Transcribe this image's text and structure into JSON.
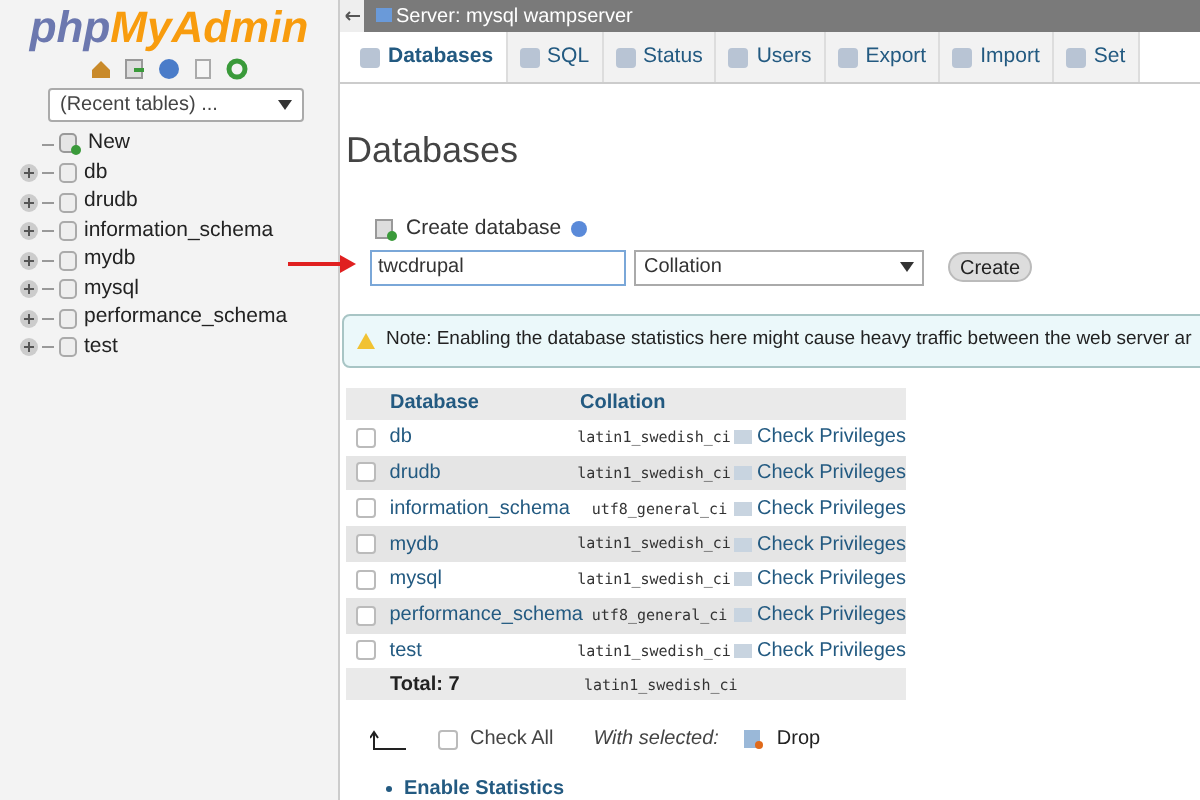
{
  "sidebar": {
    "logo": {
      "part_1": "php",
      "part_2": "MyAdmin"
    },
    "recent_tables": "(Recent tables) ...",
    "tree": [
      {
        "label": "New",
        "kind": "new"
      },
      {
        "label": "db",
        "kind": "database"
      },
      {
        "label": "drudb",
        "kind": "database"
      },
      {
        "label": "information_schema",
        "kind": "database"
      },
      {
        "label": "mydb",
        "kind": "database"
      },
      {
        "label": "mysql",
        "kind": "database"
      },
      {
        "label": "performance_schema",
        "kind": "database"
      },
      {
        "label": "test",
        "kind": "database"
      }
    ]
  },
  "breadcrumb": "Server: mysql wampserver",
  "tabs": [
    {
      "label": "Databases",
      "selected": true
    },
    {
      "label": "SQL",
      "selected": false
    },
    {
      "label": "Status",
      "selected": false
    },
    {
      "label": "Users",
      "selected": false
    },
    {
      "label": "Export",
      "selected": false
    },
    {
      "label": "Import",
      "selected": false
    },
    {
      "label": "Set",
      "selected": false
    }
  ],
  "heading": "Databases",
  "create_database": {
    "label": "Create database",
    "value": "twcdrupal",
    "collation": "Collation",
    "button": "Create"
  },
  "note": "Note: Enabling the database statistics here might cause heavy traffic between the web server ar",
  "table": {
    "columns": [
      "Database",
      "Collation"
    ],
    "rows": [
      {
        "name": "db",
        "collation": "latin1_swedish_ci",
        "action": "Check Privileges",
        "checked": false
      },
      {
        "name": "drudb",
        "collation": "latin1_swedish_ci",
        "action": "Check Privileges",
        "checked": false
      },
      {
        "name": "information_schema",
        "collation": "utf8_general_ci",
        "action": "Check Privileges",
        "checked": false
      },
      {
        "name": "mydb",
        "collation": "latin1_swedish_ci",
        "action": "Check Privileges",
        "checked": false
      },
      {
        "name": "mysql",
        "collation": "latin1_swedish_ci",
        "action": "Check Privileges",
        "checked": false
      },
      {
        "name": "performance_schema",
        "collation": "utf8_general_ci",
        "action": "Check Privileges",
        "checked": false
      },
      {
        "name": "test",
        "collation": "latin1_swedish_ci",
        "action": "Check Privileges",
        "checked": false
      }
    ],
    "total": "Total: 7",
    "total_collation": "latin1_swedish_ci"
  },
  "footer": {
    "check_all": "Check All",
    "check_all_checked": false,
    "with_selected": "With selected:",
    "drop": "Drop"
  },
  "enable_statistics": "Enable Statistics"
}
